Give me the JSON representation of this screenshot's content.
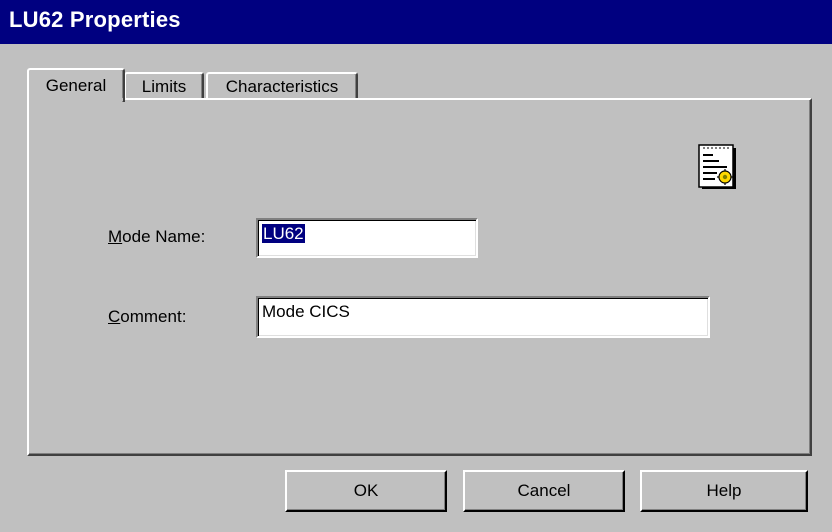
{
  "window": {
    "title": "LU62 Properties"
  },
  "tabs": [
    {
      "label": "General",
      "active": true
    },
    {
      "label": "Limits",
      "active": false
    },
    {
      "label": "Characteristics",
      "active": false
    }
  ],
  "general": {
    "icon": "properties-document-icon",
    "mode_name": {
      "label_mnemonic": "M",
      "label_rest": "ode Name:",
      "value": "LU62"
    },
    "comment": {
      "label_mnemonic": "C",
      "label_rest": "omment:",
      "value": "Mode CICS"
    }
  },
  "buttons": {
    "ok": "OK",
    "cancel": "Cancel",
    "help": "Help"
  },
  "colors": {
    "titlebar": "#000080",
    "face": "#c0c0c0",
    "selection": "#000080"
  }
}
